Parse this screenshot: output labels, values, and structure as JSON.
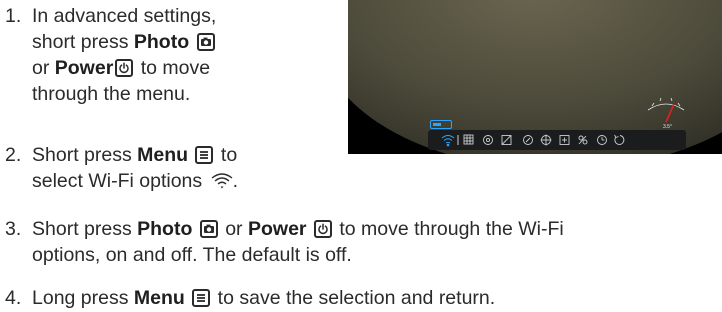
{
  "steps": [
    {
      "number": "1.",
      "lines": [
        {
          "parts": [
            "In advanced settings,"
          ]
        },
        {
          "parts": [
            "short press ",
            "Photo",
            ""
          ]
        },
        {
          "parts": [
            "or ",
            "Power",
            " to move"
          ]
        },
        {
          "parts": [
            "through the menu."
          ]
        }
      ]
    },
    {
      "number": "2.",
      "line1_pre": "Short press ",
      "line1_bold": "Menu",
      "line1_post": " to",
      "line2_text": "select Wi-Fi options",
      "line2_end": "."
    },
    {
      "number": "3.",
      "line1_pre": "Short press ",
      "line1_bold1": "Photo",
      "line1_mid": " or ",
      "line1_bold2": "Power",
      "line1_post": " to move through the Wi-Fi",
      "line2_text": "options, on and off. The default is off."
    },
    {
      "number": "4.",
      "pre": "Long press ",
      "bold": "Menu",
      "post": " to save the selection and return."
    }
  ],
  "icons": {
    "photo_key": "camera-icon",
    "power_key": "power-icon",
    "menu_key": "menu-icon",
    "wifi": "wifi-icon"
  },
  "screen": {
    "reticle_value": "3.5°",
    "accent": "#2aa4ff",
    "indicator": "#e02020"
  }
}
